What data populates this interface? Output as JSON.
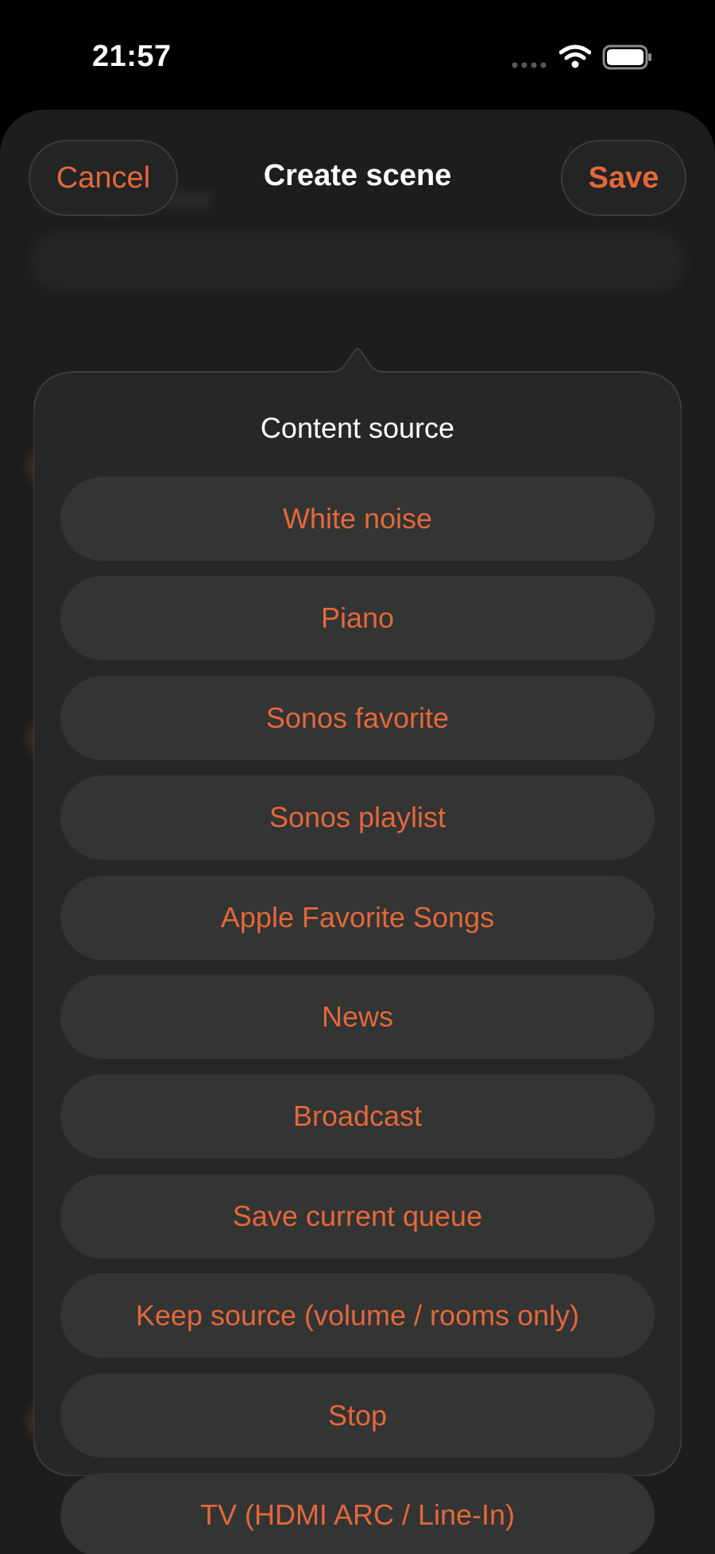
{
  "status_bar": {
    "time": "21:57"
  },
  "header": {
    "cancel_label": "Cancel",
    "title": "Create scene",
    "save_label": "Save"
  },
  "background": {
    "title_hint": "Sleep timer"
  },
  "popover": {
    "title": "Content source",
    "options": [
      "White noise",
      "Piano",
      "Sonos favorite",
      "Sonos playlist",
      "Apple Favorite Songs",
      "News",
      "Broadcast",
      "Save current queue",
      "Keep source (volume / rooms only)",
      "Stop",
      "TV (HDMI ARC / Line-In)"
    ]
  },
  "colors": {
    "accent": "#e4683a",
    "sheet_background": "#1c1d1d",
    "option_background": "#333434",
    "popover_background": "#262727"
  },
  "icons": {
    "signal": "cellular-signal-icon",
    "wifi": "wifi-icon",
    "battery": "battery-icon"
  }
}
